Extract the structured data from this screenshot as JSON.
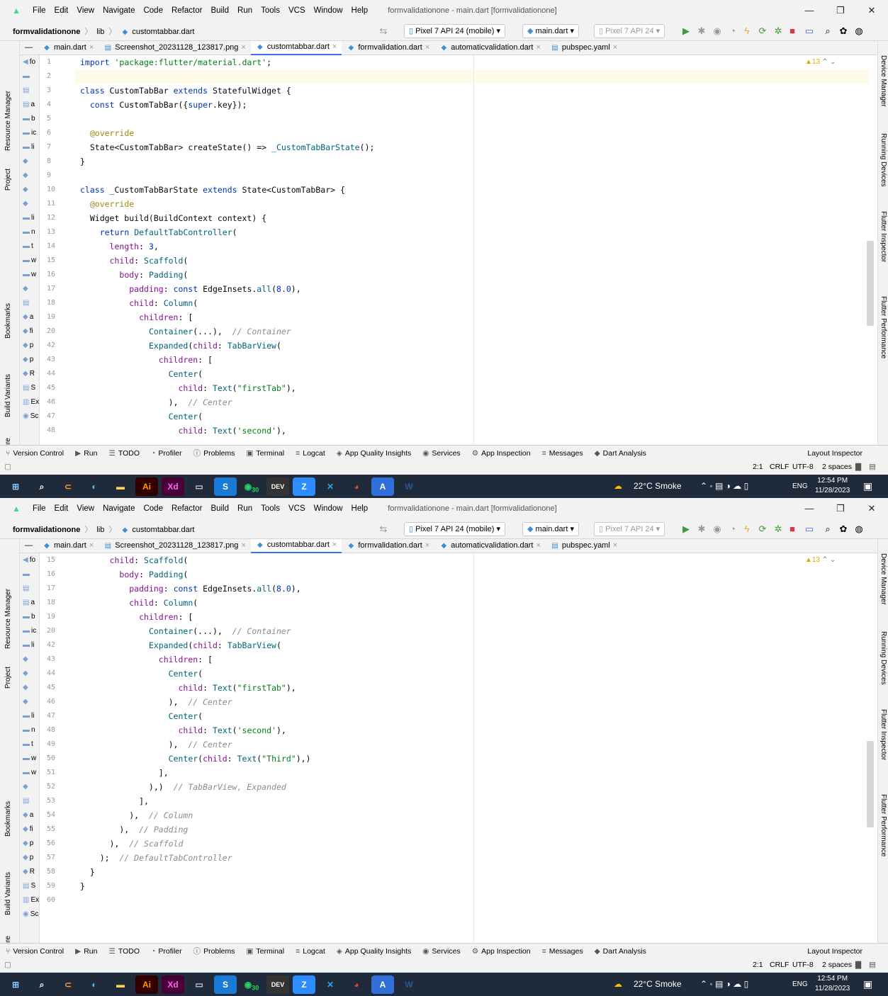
{
  "menu": [
    "File",
    "Edit",
    "View",
    "Navigate",
    "Code",
    "Refactor",
    "Build",
    "Run",
    "Tools",
    "VCS",
    "Window",
    "Help"
  ],
  "window_title": "formvalidationone - main.dart [formvalidationone]",
  "breadcrumb": {
    "project": "formvalidationone",
    "folder": "lib",
    "file": "customtabbar.dart"
  },
  "toolbar": {
    "device": "Pixel 7 API 24 (mobile)",
    "run_config": "main.dart",
    "inactive_device": "Pixel 7 API 24"
  },
  "tabs": [
    "main.dart",
    "Screenshot_20231128_123817.png",
    "customtabbar.dart",
    "formvalidation.dart",
    "automaticvalidation.dart",
    "pubspec.yaml"
  ],
  "active_tab": 2,
  "left_strip": [
    "Resource Manager",
    "Project",
    "Bookmarks",
    "Build Variants",
    "Structure"
  ],
  "right_strip": [
    "Device Manager",
    "Running Devices",
    "Flutter Inspector",
    "Flutter Performance"
  ],
  "project_items": [
    "fo",
    "",
    "",
    "a",
    "b",
    "ic",
    "li",
    "",
    "",
    "",
    "",
    "li",
    "n",
    "t",
    "w",
    "w",
    "",
    "",
    "a",
    "fi",
    "p",
    "p",
    "R",
    "S",
    "Ex",
    "Sc"
  ],
  "warnings": "▲13",
  "tool_windows": [
    "Version Control",
    "Run",
    "TODO",
    "Profiler",
    "Problems",
    "Terminal",
    "Logcat",
    "App Quality Insights",
    "Services",
    "App Inspection",
    "Messages",
    "Dart Analysis"
  ],
  "layout_inspector": "Layout Inspector",
  "status": {
    "position": "2:1",
    "line_sep": "CRLF",
    "encoding": "UTF-8",
    "indent": "2 spaces"
  },
  "weather": "22°C  Smoke",
  "lang": "ENG",
  "time": "12:54 PM",
  "date": "11/28/2023",
  "taskbar_badge": "30",
  "editors": [
    {
      "lines": [
        1,
        2,
        3,
        4,
        5,
        6,
        7,
        8,
        9,
        10,
        11,
        12,
        13,
        14,
        15,
        16,
        17,
        18,
        19,
        20,
        42,
        43,
        44,
        45,
        46,
        47,
        48
      ],
      "code": [
        "<span class='kw'>import</span> <span class='str'>'package:flutter/material.dart'</span>;",
        "",
        "<span class='kw'>class</span> CustomTabBar <span class='kw'>extends</span> StatefulWidget {",
        "  <span class='kw'>const</span> CustomTabBar({<span class='kw'>super</span>.key});",
        "",
        "  <span class='ann'>@override</span>",
        "  State&lt;CustomTabBar&gt; createState() =&gt; <span class='cls'>_CustomTabBarState</span>();",
        "}",
        "",
        "<span class='kw'>class</span> _CustomTabBarState <span class='kw'>extends</span> State&lt;CustomTabBar&gt; {",
        "  <span class='ann'>@override</span>",
        "  Widget build(BuildContext context) {",
        "    <span class='kw'>return</span> <span class='cls'>DefaultTabController</span>(",
        "      <span class='prm'>length</span>: <span class='kw'>3</span>,",
        "      <span class='prm'>child</span>: <span class='cls'>Scaffold</span>(",
        "        <span class='prm'>body</span>: <span class='cls'>Padding</span>(",
        "          <span class='prm'>padding</span>: <span class='kw'>const</span> EdgeInsets.<span class='cls'>all</span>(<span class='kw'>8.0</span>),",
        "          <span class='prm'>child</span>: <span class='cls'>Column</span>(",
        "            <span class='prm'>children</span>: [",
        "              <span class='cls'>Container</span>(...),  <span class='cmt'>// Container</span>",
        "              <span class='cls'>Expanded</span>(<span class='prm'>child</span>: <span class='cls'>TabBarView</span>(",
        "                <span class='prm'>children</span>: [",
        "                  <span class='cls'>Center</span>(",
        "                    <span class='prm'>child</span>: <span class='cls'>Text</span>(<span class='str'>\"firstTab\"</span>),",
        "                  ),  <span class='cmt'>// Center</span>",
        "                  <span class='cls'>Center</span>(",
        "                    <span class='prm'>child</span>: <span class='cls'>Text</span>(<span class='str'>'second'</span>),"
      ]
    },
    {
      "lines": [
        15,
        16,
        17,
        18,
        19,
        20,
        42,
        43,
        44,
        45,
        46,
        47,
        48,
        49,
        50,
        51,
        52,
        53,
        54,
        55,
        56,
        57,
        58,
        59,
        60
      ],
      "code": [
        "      <span class='prm'>child</span>: <span class='cls'>Scaffold</span>(",
        "        <span class='prm'>body</span>: <span class='cls'>Padding</span>(",
        "          <span class='prm'>padding</span>: <span class='kw'>const</span> EdgeInsets.<span class='cls'>all</span>(<span class='kw'>8.0</span>),",
        "          <span class='prm'>child</span>: <span class='cls'>Column</span>(",
        "            <span class='prm'>children</span>: [",
        "              <span class='cls'>Container</span>(...),  <span class='cmt'>// Container</span>",
        "              <span class='cls'>Expanded</span>(<span class='prm'>child</span>: <span class='cls'>TabBarView</span>(",
        "                <span class='prm'>children</span>: [",
        "                  <span class='cls'>Center</span>(",
        "                    <span class='prm'>child</span>: <span class='cls'>Text</span>(<span class='str'>\"firstTab\"</span>),",
        "                  ),  <span class='cmt'>// Center</span>",
        "                  <span class='cls'>Center</span>(",
        "                    <span class='prm'>child</span>: <span class='cls'>Text</span>(<span class='str'>'second'</span>),",
        "                  ),  <span class='cmt'>// Center</span>",
        "                  <span class='cls'>Center</span>(<span class='prm'>child</span>: <span class='cls'>Text</span>(<span class='str'>\"Third\"</span>),)",
        "                ],",
        "              ),)  <span class='cmt'>// TabBarView, Expanded</span>",
        "            ],",
        "          ),  <span class='cmt'>// Column</span>",
        "        ),  <span class='cmt'>// Padding</span>",
        "      ),  <span class='cmt'>// Scaffold</span>",
        "    );  <span class='cmt'>// DefaultTabController</span>",
        "  }",
        "}",
        ""
      ]
    }
  ]
}
